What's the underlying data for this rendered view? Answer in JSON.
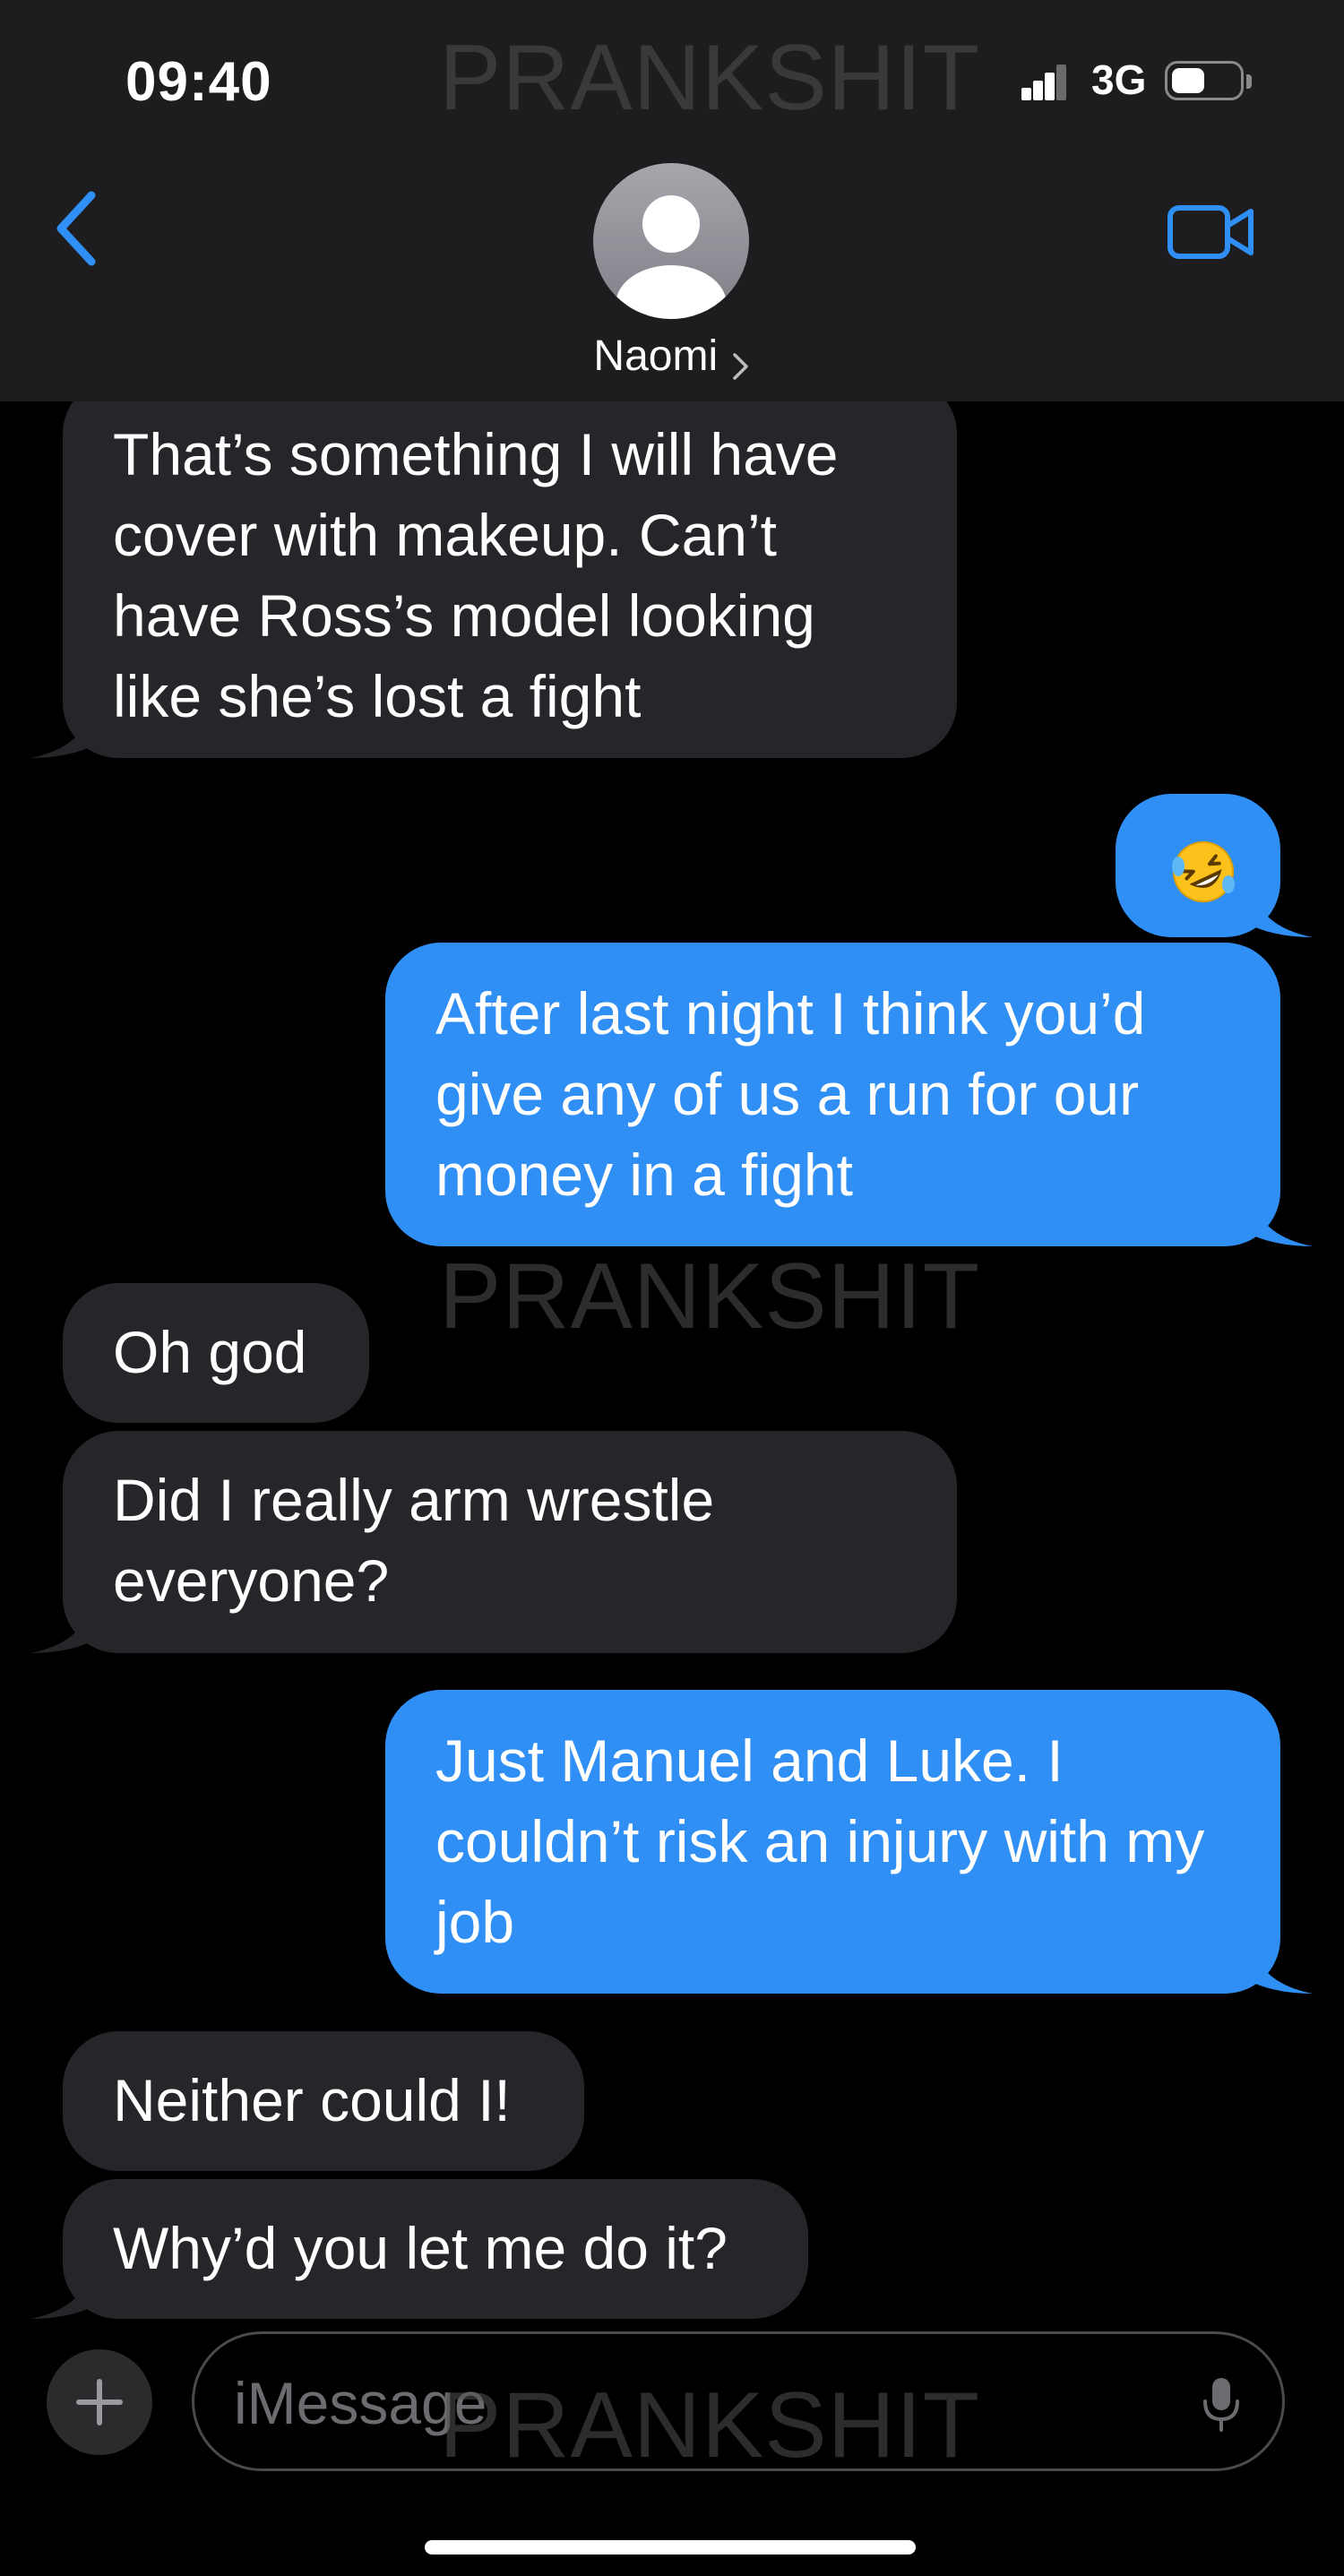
{
  "status_bar": {
    "time": "09:40",
    "network": "3G"
  },
  "contact": {
    "name": "Naomi"
  },
  "watermark_text": "PRANKSHIT",
  "messages": [
    {
      "direction": "incoming",
      "text": "That’s something I will have cover with makeup. Can’t have Ross’s model looking like she’s lost a fight"
    },
    {
      "direction": "outgoing",
      "text": "🤣"
    },
    {
      "direction": "outgoing",
      "text": "After last night I think you’d give any of us a run for our money in a fight"
    },
    {
      "direction": "incoming",
      "text": "Oh god"
    },
    {
      "direction": "incoming",
      "text": "Did I really arm wrestle everyone?"
    },
    {
      "direction": "outgoing",
      "text": "Just Manuel and Luke. I couldn’t risk an injury with my job"
    },
    {
      "direction": "incoming",
      "text": "Neither could I!"
    },
    {
      "direction": "incoming",
      "text": "Why’d you let me do it?"
    }
  ],
  "input": {
    "placeholder": "iMessage",
    "value": ""
  },
  "icons": {
    "back": "chevron-left-icon",
    "video": "video-camera-icon",
    "plus": "plus-icon",
    "mic": "microphone-icon",
    "avatar": "person-silhouette-icon"
  },
  "colors": {
    "accent": "#2f8ff5",
    "incoming_bubble": "#26262a",
    "background": "#000000",
    "header": "#1d1d1f"
  }
}
